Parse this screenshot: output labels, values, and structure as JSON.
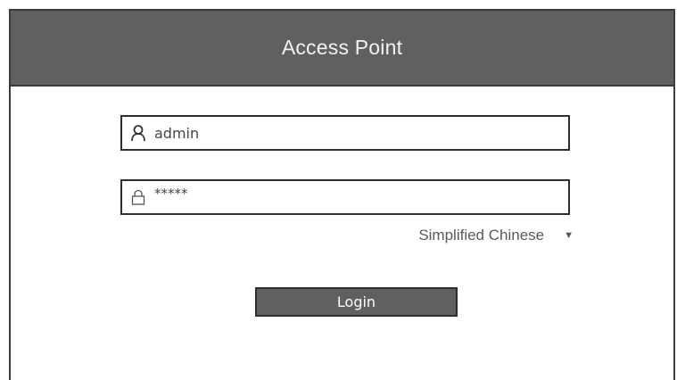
{
  "header": {
    "title": "Access Point"
  },
  "login_form": {
    "username": {
      "value": "admin",
      "icon": "user-icon"
    },
    "password": {
      "value": "*****",
      "icon": "lock-icon"
    },
    "language": {
      "selected": "Simplified Chinese",
      "icon": "triangle-down-icon"
    },
    "login_label": "Login"
  },
  "colors": {
    "header_bg": "#606060",
    "button_bg": "#606060",
    "border": "#2e2e2e"
  }
}
